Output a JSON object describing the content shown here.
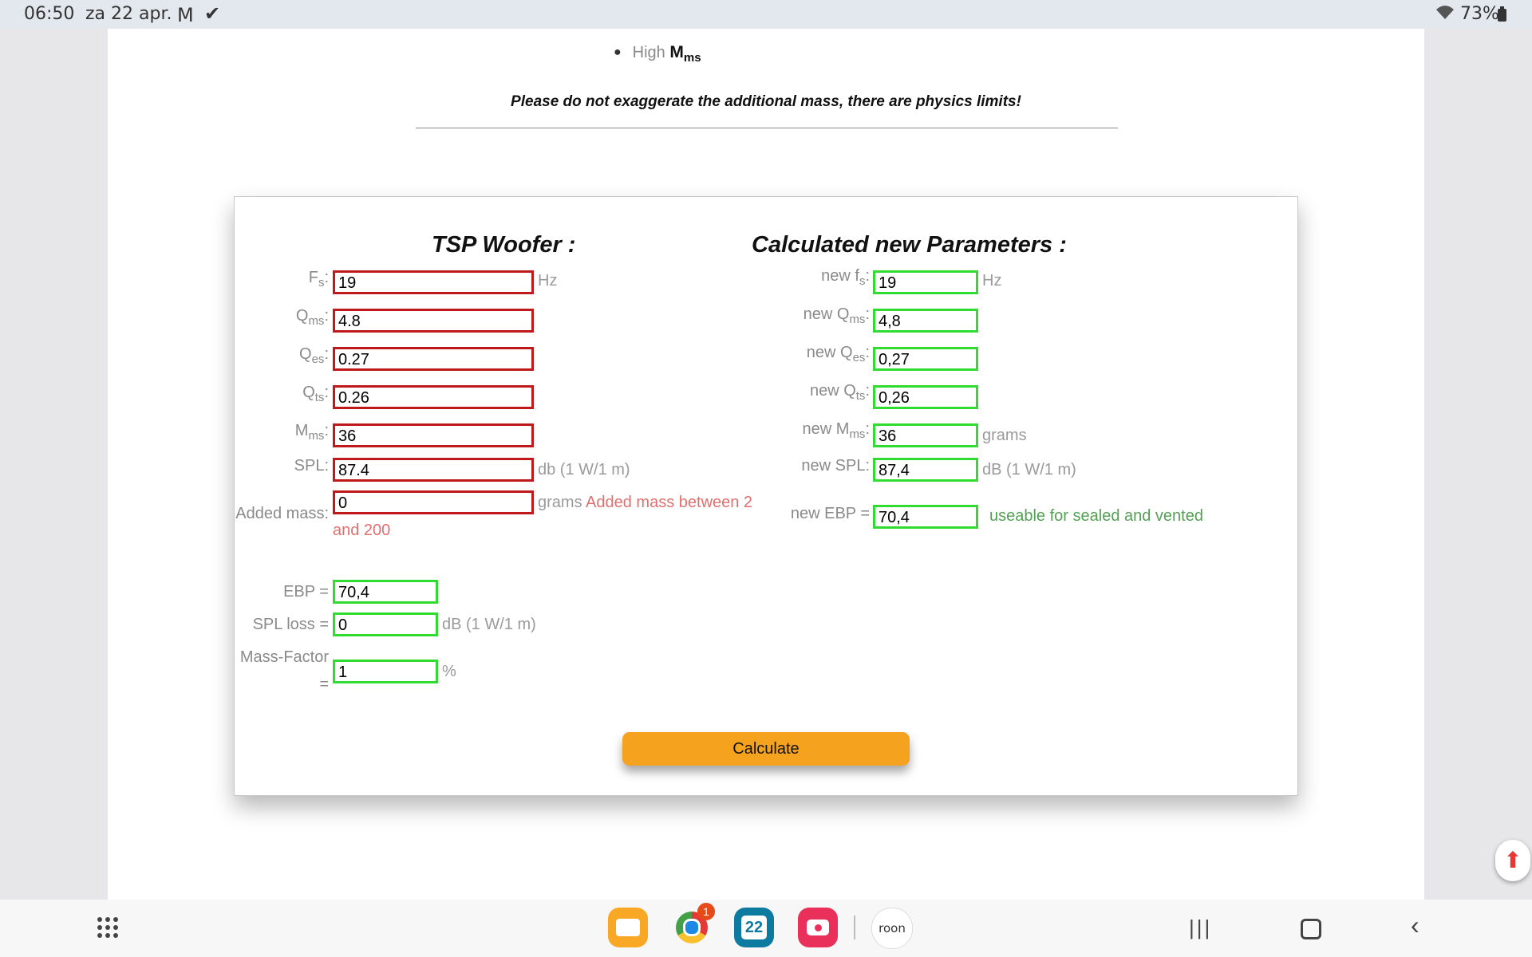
{
  "status_bar": {
    "time": "06:50",
    "date": "za 22 apr.",
    "battery": "73%"
  },
  "intro": {
    "bullet_text": "High",
    "bullet_symbol": "M",
    "bullet_sub": "ms",
    "warning": "Please do not exaggerate the additional mass, there are physics limits!"
  },
  "tsp_woofer": {
    "heading": "TSP Woofer :",
    "fs": {
      "sym": "F",
      "sub": "s",
      "value": "19",
      "unit": "Hz"
    },
    "qms": {
      "sym": "Q",
      "sub": "ms",
      "value": "4.8"
    },
    "qes": {
      "sym": "Q",
      "sub": "es",
      "value": "0.27"
    },
    "qts": {
      "sym": "Q",
      "sub": "ts",
      "value": "0.26"
    },
    "mms": {
      "sym": "M",
      "sub": "ms",
      "value": "36"
    },
    "spl": {
      "label": "SPL:",
      "value": "87.4",
      "unit": "db (1 W/1 m)"
    },
    "added_mass": {
      "label": "Added mass:",
      "value": "0",
      "unit": "grams",
      "hint_line1": "Added mass between 2",
      "hint_line2": "and 200"
    },
    "ebp": {
      "label": "EBP =",
      "value": "70,4"
    },
    "spl_loss": {
      "label": "SPL loss =",
      "value": "0",
      "unit": "dB (1 W/1 m)"
    },
    "mass_factor": {
      "label_line1": "Mass-Factor",
      "label_line2": "=",
      "value": "1",
      "unit": "%"
    }
  },
  "calculated": {
    "heading": "Calculated new Parameters :",
    "fs": {
      "prefix": "new f",
      "sub": "s",
      "value": "19",
      "unit": "Hz"
    },
    "qms": {
      "prefix": "new Q",
      "sub": "ms",
      "value": "4,8"
    },
    "qes": {
      "prefix": "new Q",
      "sub": "es",
      "value": "0,27"
    },
    "qts": {
      "prefix": "new Q",
      "sub": "ts",
      "value": "0,26"
    },
    "mms": {
      "prefix": "new M",
      "sub": "ms",
      "value": "36",
      "unit": "grams"
    },
    "spl": {
      "label": "new SPL:",
      "value": "87,4",
      "unit": "dB (1 W/1 m)"
    },
    "ebp": {
      "label": "new EBP =",
      "value": "70,4",
      "note": "useable for sealed and vented"
    }
  },
  "calculate_button": "Calculate",
  "dock": {
    "chrome_badge": "1",
    "calendar_day": "22",
    "roon_label": "roon"
  },
  "colors": {
    "input_border": "#c0191c",
    "output_border": "#2fdc2f",
    "button": "#f5a21f"
  }
}
